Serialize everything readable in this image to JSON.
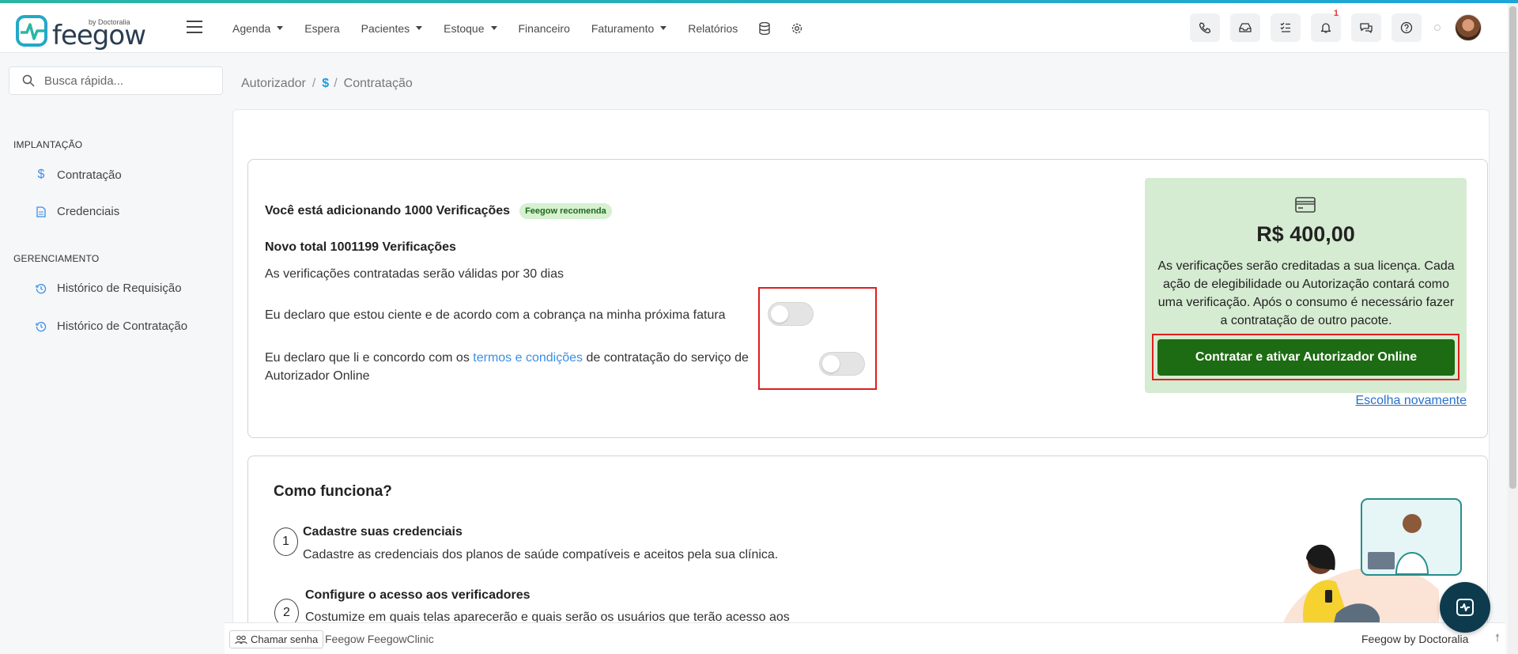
{
  "brand": {
    "byline": "by Doctoralia",
    "name": "feegow"
  },
  "nav": [
    {
      "label": "Agenda",
      "dropdown": true
    },
    {
      "label": "Espera",
      "dropdown": false
    },
    {
      "label": "Pacientes",
      "dropdown": true
    },
    {
      "label": "Estoque",
      "dropdown": true
    },
    {
      "label": "Financeiro",
      "dropdown": false
    },
    {
      "label": "Faturamento",
      "dropdown": true
    },
    {
      "label": "Relatórios",
      "dropdown": false
    }
  ],
  "notifications": {
    "count": "1"
  },
  "search": {
    "placeholder": "Busca rápida..."
  },
  "sidebar": {
    "section1": "IMPLANTAÇÃO",
    "item1": "Contratação",
    "item2": "Credenciais",
    "section2": "GERENCIAMENTO",
    "item3": "Histórico de Requisição",
    "item4": "Histórico de Contratação"
  },
  "breadcrumb": {
    "root": "Autorizador",
    "current": "Contratação"
  },
  "plan": {
    "adding": "Você está adicionando 1000 Verificações",
    "recommend": "Feegow recomenda",
    "new_total": "Novo total 1001199 Verificações",
    "validity": "As verificações contratadas serão válidas por 30 dias",
    "declare1": "Eu declaro que estou ciente e de acordo com a cobrança na minha próxima fatura",
    "declare2_pre": "Eu declaro que li e concordo com os ",
    "declare2_link": "termos e condições",
    "declare2_post": " de contratação do serviço de Autorizador Online",
    "toggle1_on": false,
    "toggle2_on": false
  },
  "price": {
    "value": "R$ 400,00",
    "description": "As verificações serão creditadas a sua licença. Cada ação de elegibilidade ou Autorização contará como uma verificação. Após o consumo é necessário fazer a contratação de outro pacote.",
    "button": "Contratar e ativar Autorizador Online",
    "choose_again": "Escolha novamente"
  },
  "how": {
    "title": "Como funciona?",
    "steps": [
      {
        "num": "1",
        "title": "Cadastre suas credenciais",
        "desc": "Cadastre as credenciais dos planos de saúde compatíveis e aceitos pela sua clínica."
      },
      {
        "num": "2",
        "title": "Configure o acesso aos verificadores",
        "desc": "Costumize em quais telas aparecerão e quais serão os usuários que terão acesso aos"
      }
    ]
  },
  "footer": {
    "call": "Chamar senha",
    "left": "Feegow FeegowClinic",
    "right": "Feegow by Doctoralia"
  },
  "colors": {
    "accent": "#1f9ae0",
    "buy_button": "#1d6b12",
    "price_bg": "#d6ecd2",
    "highlight": "#e01e1e"
  }
}
